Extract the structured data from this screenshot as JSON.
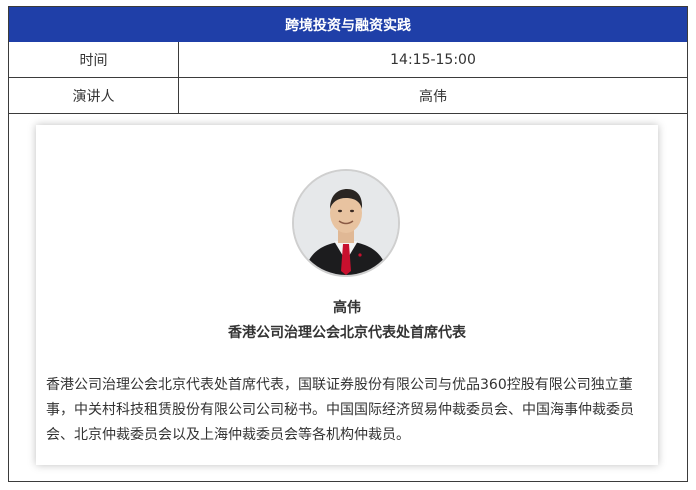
{
  "header": {
    "title": "跨境投资与融资实践"
  },
  "rows": [
    {
      "label": "时间",
      "value": "14:15-15:00"
    },
    {
      "label": "演讲人",
      "value": "高伟"
    }
  ],
  "speaker": {
    "name": "高伟",
    "title": "香港公司治理公会北京代表处首席代表",
    "bio": "香港公司治理公会北京代表处首席代表，国联证券股份有限公司与优品360控股有限公司独立董事，中关村科技租赁股份有限公司公司秘书。中国国际经济贸易仲裁委员会、中国海事仲裁委员会、北京仲裁委员会以及上海仲裁委员会等各机构仲裁员。"
  },
  "colors": {
    "header_bg": "#1f3fa8",
    "tie": "#c8102e"
  }
}
